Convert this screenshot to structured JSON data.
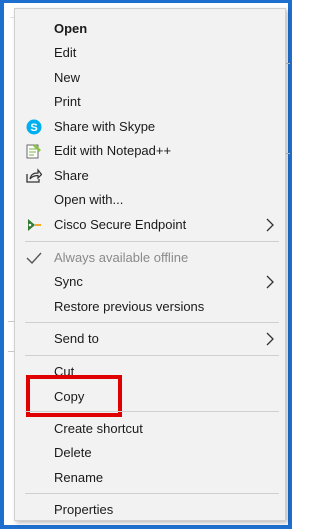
{
  "menu": {
    "items": [
      {
        "label": "Open"
      },
      {
        "label": "Edit"
      },
      {
        "label": "New"
      },
      {
        "label": "Print"
      },
      {
        "label": "Share with Skype"
      },
      {
        "label": "Edit with Notepad++"
      },
      {
        "label": "Share"
      },
      {
        "label": "Open with..."
      },
      {
        "label": "Cisco Secure Endpoint"
      },
      {
        "label": "Always available offline"
      },
      {
        "label": "Sync"
      },
      {
        "label": "Restore previous versions"
      },
      {
        "label": "Send to"
      },
      {
        "label": "Cut"
      },
      {
        "label": "Copy"
      },
      {
        "label": "Create shortcut"
      },
      {
        "label": "Delete"
      },
      {
        "label": "Rename"
      },
      {
        "label": "Properties"
      }
    ]
  },
  "colors": {
    "frame": "#1f6fcf",
    "highlight_box": "#e00000",
    "menu_background": "#f2f2f2",
    "skype_icon": "#00aff0",
    "cisco_icon": "#2e7d32"
  },
  "icons": {
    "share_with_skype": "skype-icon",
    "edit_with_notepad": "notepad-plus-icon",
    "share": "share-icon",
    "cisco_secure_endpoint": "cisco-secure-endpoint-icon",
    "always_available_offline": "checkmark-icon",
    "submenu": "chevron-right-icon"
  }
}
